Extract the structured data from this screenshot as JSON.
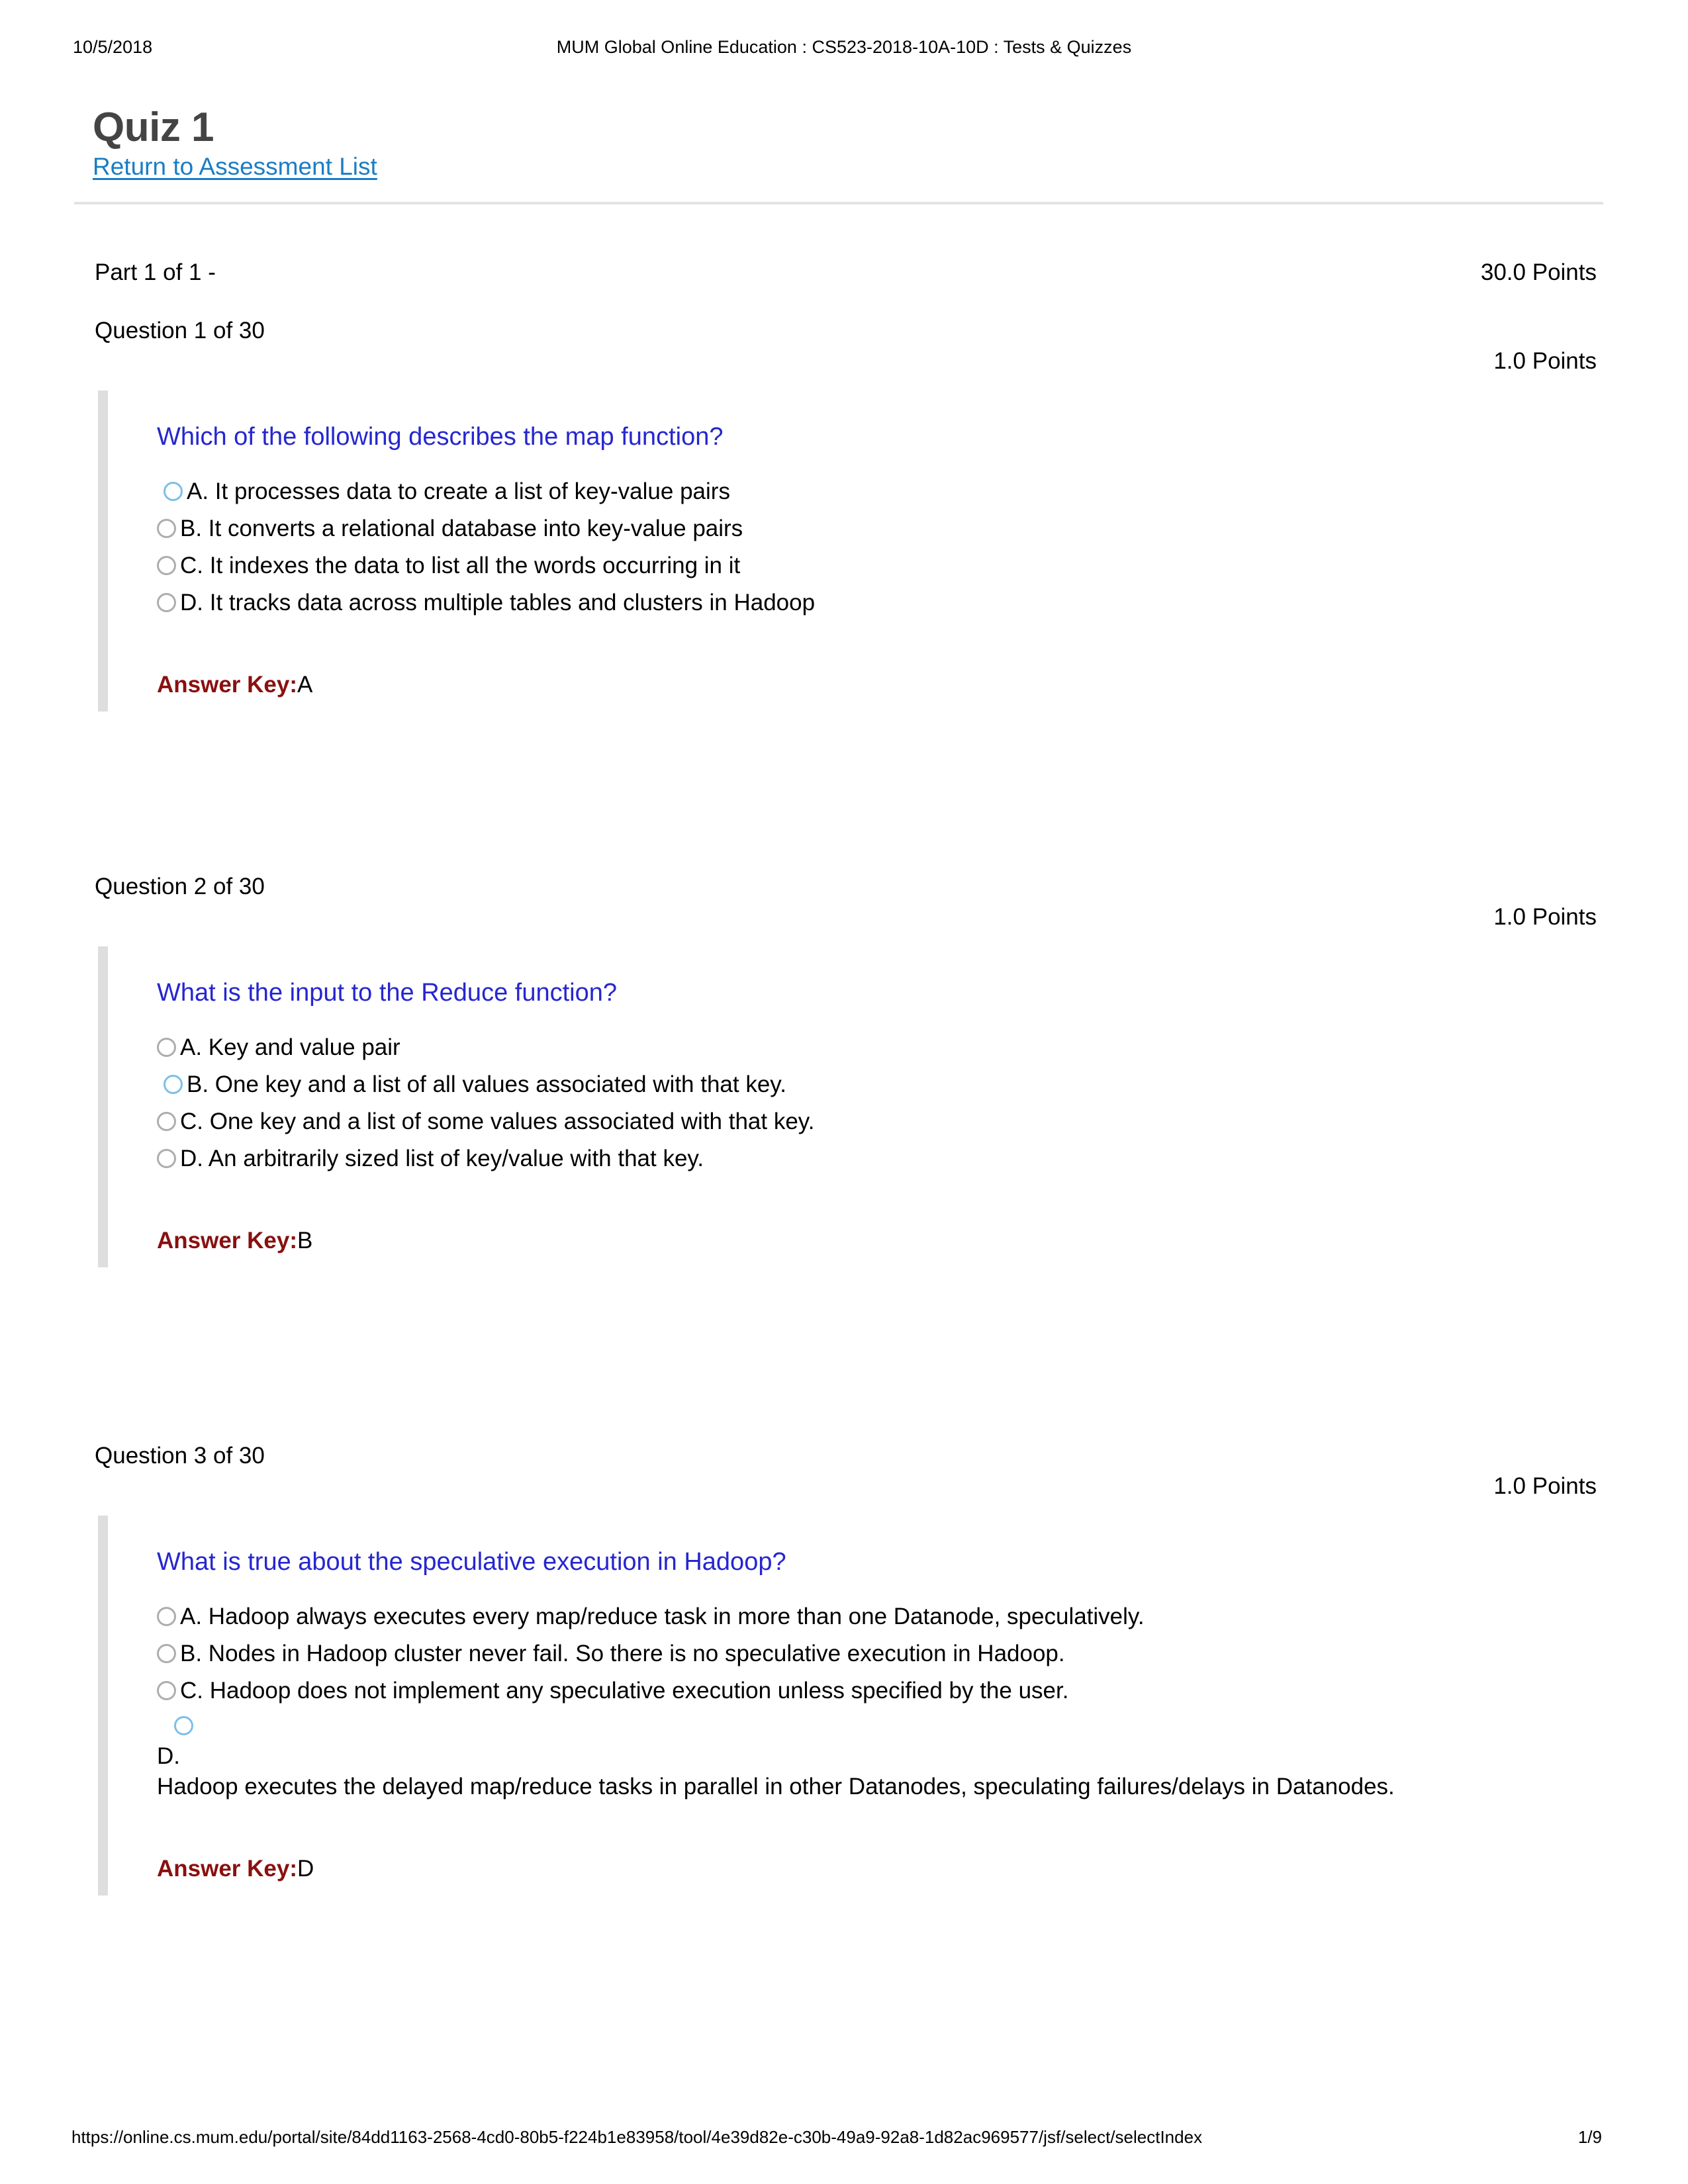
{
  "browser_header": {
    "date": "10/5/2018",
    "title": "MUM Global Online Education : CS523-2018-10A-10D : Tests & Quizzes"
  },
  "page": {
    "title": "Quiz 1",
    "return_link": "Return to Assessment List"
  },
  "part": {
    "label": "Part 1 of 1 -",
    "points": "30.0 Points"
  },
  "questions": [
    {
      "number": "Question 1 of 30",
      "points": "1.0 Points",
      "text": "Which of the following describes the map function?",
      "options": [
        {
          "text": "A. It processes data to create a list of key-value pairs",
          "selected": true
        },
        {
          "text": "B. It converts a relational database into key-value pairs",
          "selected": false
        },
        {
          "text": "C. It indexes the data to list all the words occurring in it",
          "selected": false
        },
        {
          "text": "D. It tracks data across multiple tables and clusters in Hadoop",
          "selected": false
        }
      ],
      "answer_key_label": "Answer Key:",
      "answer_key_value": "A"
    },
    {
      "number": "Question 2 of 30",
      "points": "1.0 Points",
      "text": "What is the input to the Reduce function?",
      "options": [
        {
          "text": "A. Key and value pair",
          "selected": false
        },
        {
          "text": "B. One key and a list of all values associated with that key.",
          "selected": true
        },
        {
          "text": "C. One key and a list of some values associated with that key.",
          "selected": false
        },
        {
          "text": "D. An arbitrarily sized list of key/value with that key.",
          "selected": false
        }
      ],
      "answer_key_label": "Answer Key:",
      "answer_key_value": "B"
    },
    {
      "number": "Question 3 of 30",
      "points": "1.0 Points",
      "text": "What is true about the speculative execution in Hadoop?",
      "options": [
        {
          "text": "A. Hadoop always executes every map/reduce task in more than one Datanode, speculatively.",
          "selected": false
        },
        {
          "text": "B. Nodes in Hadoop cluster never fail. So there is no speculative execution in Hadoop.",
          "selected": false
        },
        {
          "text": "C. Hadoop does not implement any speculative execution unless specified by the user.",
          "selected": false
        },
        {
          "letter": "D.",
          "text": "Hadoop executes the delayed map/reduce tasks in parallel in other Datanodes, speculating failures/delays in Datanodes.",
          "selected": true,
          "stacked": true
        }
      ],
      "answer_key_label": "Answer Key:",
      "answer_key_value": "D"
    }
  ],
  "footer": {
    "url": "https://online.cs.mum.edu/portal/site/84dd1163-2568-4cd0-80b5-f224b1e83958/tool/4e39d82e-c30b-49a9-92a8-1d82ac969577/jsf/select/selectIndex",
    "page_number": "1/9"
  },
  "colors": {
    "question_text": "#2626cf",
    "link": "#1a7dc4",
    "answer_key": "#8a1010",
    "selected_radio": "#7cc0e8",
    "unselected_radio": "#adadad",
    "accent_bar": "#dedede",
    "title": "#444444"
  }
}
